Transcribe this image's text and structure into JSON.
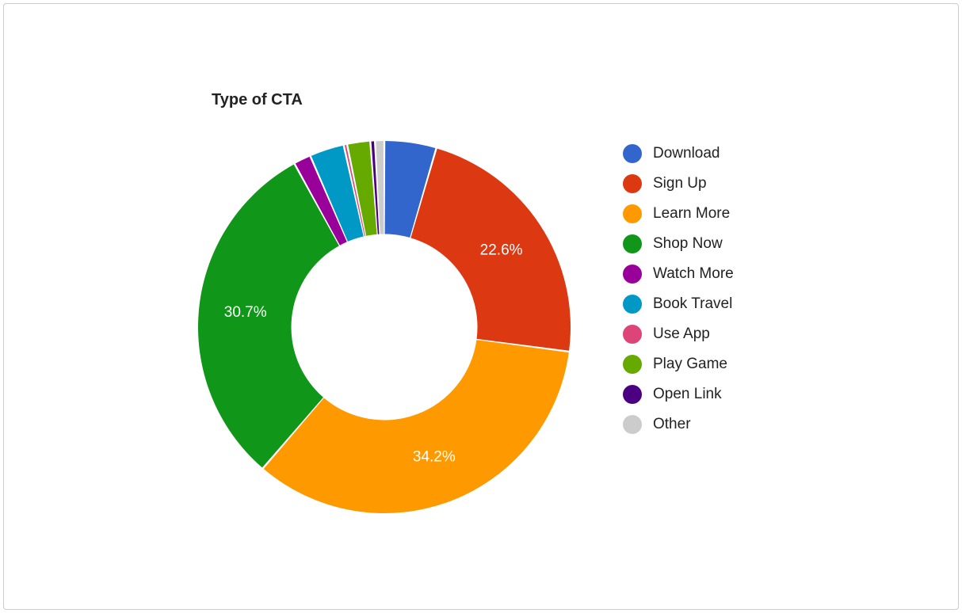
{
  "chart_data": {
    "type": "pie",
    "title": "Type of CTA",
    "series": [
      {
        "name": "Download",
        "value": 4.5,
        "color": "#3366cc",
        "show_label": false
      },
      {
        "name": "Sign Up",
        "value": 22.6,
        "color": "#dc3912",
        "show_label": true
      },
      {
        "name": "Learn More",
        "value": 34.2,
        "color": "#ff9900",
        "show_label": true
      },
      {
        "name": "Shop Now",
        "value": 30.7,
        "color": "#109618",
        "show_label": true
      },
      {
        "name": "Watch More",
        "value": 1.5,
        "color": "#990099",
        "show_label": false
      },
      {
        "name": "Book Travel",
        "value": 3.0,
        "color": "#0099c6",
        "show_label": false
      },
      {
        "name": "Use App",
        "value": 0.3,
        "color": "#dd4477",
        "show_label": false
      },
      {
        "name": "Play Game",
        "value": 2.0,
        "color": "#66aa00",
        "show_label": false
      },
      {
        "name": "Open Link",
        "value": 0.4,
        "color": "#4b0082",
        "show_label": false
      },
      {
        "name": "Other",
        "value": 0.8,
        "color": "#cccccc",
        "show_label": false
      }
    ],
    "donut_inner_ratio": 0.5,
    "label_format": "{v}%"
  }
}
